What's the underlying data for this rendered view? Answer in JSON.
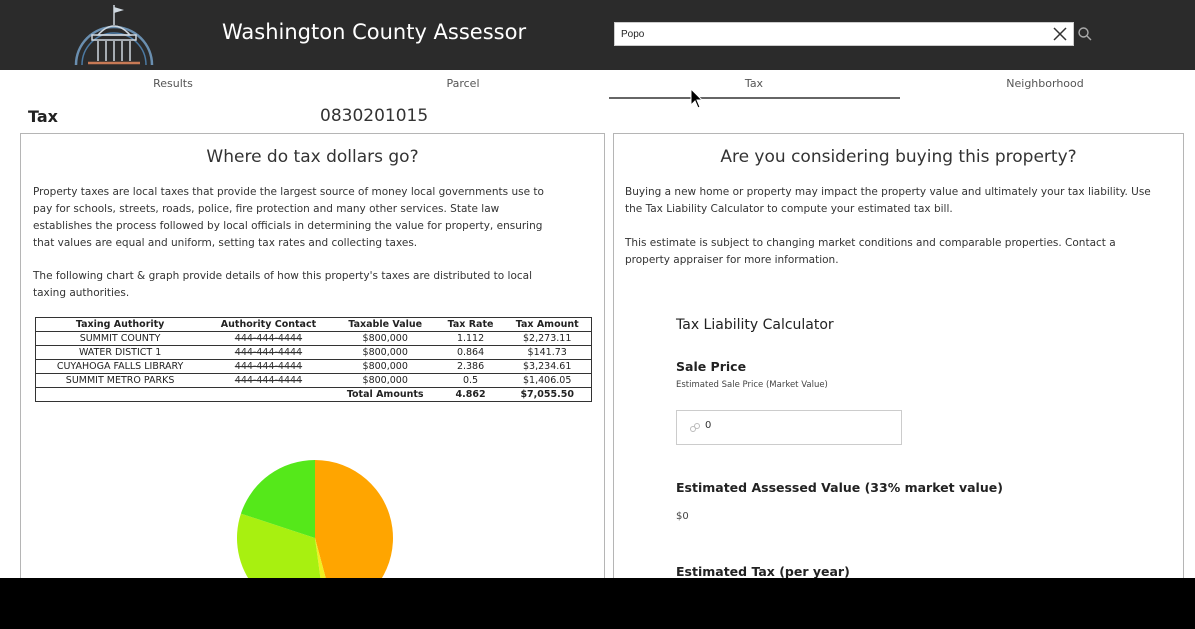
{
  "header": {
    "title": "Washington County Assessor",
    "search": {
      "value": "Popo",
      "placeholder": ""
    },
    "icons": [
      "courthouse-logo-icon",
      "close-icon",
      "search-icon"
    ],
    "background_color": "#2b2b2b"
  },
  "tabs": [
    {
      "label": "Results"
    },
    {
      "label": "Parcel"
    },
    {
      "label": "Tax",
      "active": true
    },
    {
      "label": "Neighborhood"
    }
  ],
  "page": {
    "section_title": "Tax",
    "parcel_id": "0830201015"
  },
  "left_panel": {
    "heading": "Where do tax dollars go?",
    "para1_lines": [
      "Property taxes are local taxes that provide the largest source of money local governments use to",
      "pay for schools, streets, roads, police, fire protection and many other services. State law",
      "establishes the process followed by local officials in determining the value for property, ensuring",
      "that values are equal and uniform, setting tax rates and collecting taxes."
    ],
    "para2_lines": [
      "The following chart & graph provide details of how this property's taxes are distributed to local",
      "taxing authorities."
    ],
    "table": {
      "headers": [
        "Taxing Authority",
        "Authority Contact",
        "Taxable Value",
        "Tax Rate",
        "Tax Amount"
      ],
      "rows": [
        [
          "SUMMIT COUNTY",
          "444-444-4444",
          "$800,000",
          "1.112",
          "$2,273.11"
        ],
        [
          "WATER DISTICT 1",
          "444-444-4444",
          "$800,000",
          "0.864",
          "$141.73"
        ],
        [
          "CUYAHOGA FALLS LIBRARY",
          "444-444-4444",
          "$800,000",
          "2.386",
          "$3,234.61"
        ],
        [
          "SUMMIT METRO PARKS",
          "444-444-4444",
          "$800,000",
          "0.5",
          "$1,406.05"
        ]
      ],
      "total": {
        "label": "Total Amounts",
        "rate": "4.862",
        "amount": "$7,055.50"
      }
    },
    "pie": {
      "slices": [
        {
          "value": 3234.61,
          "color": "#ffa500"
        },
        {
          "value": 141.73,
          "color": "#f0f020"
        },
        {
          "value": 2273.11,
          "color": "#a8f010"
        },
        {
          "value": 1406.05,
          "color": "#55e81a"
        }
      ]
    }
  },
  "right_panel": {
    "heading": "Are you considering buying this property?",
    "para1_lines": [
      "Buying a new home or property may impact the property value and ultimately your tax liability.  Use",
      "the Tax Liability Calculator to compute your estimated tax bill."
    ],
    "para2_lines": [
      "This estimate is subject to changing market conditions and comparable properties.  Contact a",
      "property appraiser for more information."
    ],
    "calculator": {
      "title": "Tax Liability Calculator",
      "sale_price_label": "Sale Price",
      "sale_price_hint": "Estimated Sale Price (Market Value)",
      "sale_price_value": "0",
      "assessed_label": "Estimated Assessed Value (33% market value)",
      "assessed_value": "$0",
      "tax_label": "Estimated Tax (per year)"
    }
  }
}
